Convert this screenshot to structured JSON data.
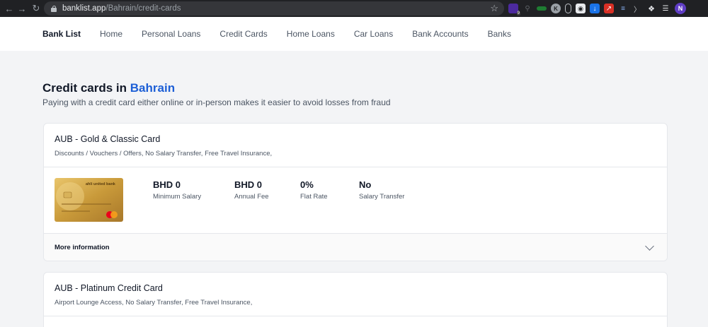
{
  "browser": {
    "url_host": "banklist.app",
    "url_path": "/Bahrain/credit-cards",
    "profile_initial": "N",
    "ext_badge": "9"
  },
  "nav": {
    "brand": "Bank List",
    "links": [
      "Home",
      "Personal Loans",
      "Credit Cards",
      "Home Loans",
      "Car Loans",
      "Bank Accounts",
      "Banks"
    ]
  },
  "page": {
    "title_prefix": "Credit cards in",
    "country": "Bahrain",
    "subtitle": "Paying with a credit card either online or in-person makes it easier to avoid losses from fraud"
  },
  "cards": [
    {
      "name": "AUB - Gold & Classic Card",
      "features": "Discounts / Vouchers / Offers, No Salary Transfer, Free Travel Insurance,",
      "image_text": "ahli united bank",
      "stats": [
        {
          "value": "BHD 0",
          "label": "Minimum Salary"
        },
        {
          "value": "BHD 0",
          "label": "Annual Fee"
        },
        {
          "value": "0%",
          "label": "Flat Rate"
        },
        {
          "value": "No",
          "label": "Salary Transfer"
        }
      ],
      "more_label": "More information"
    },
    {
      "name": "AUB - Platinum Credit Card",
      "features": "Airport Lounge Access, No Salary Transfer, Free Travel Insurance,"
    }
  ]
}
